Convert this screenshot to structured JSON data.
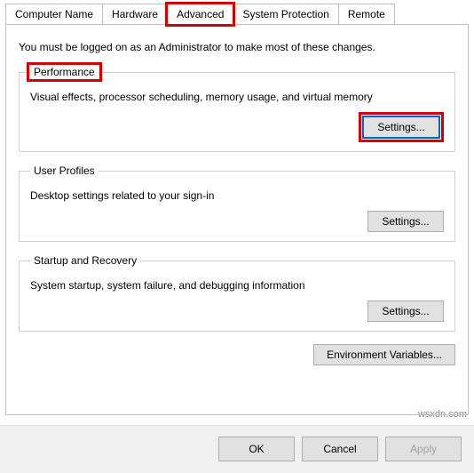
{
  "tabs": {
    "computer_name": "Computer Name",
    "hardware": "Hardware",
    "advanced": "Advanced",
    "system_protection": "System Protection",
    "remote": "Remote"
  },
  "intro": "You must be logged on as an Administrator to make most of these changes.",
  "performance": {
    "legend": "Performance",
    "desc": "Visual effects, processor scheduling, memory usage, and virtual memory",
    "button": "Settings..."
  },
  "user_profiles": {
    "legend": "User Profiles",
    "desc": "Desktop settings related to your sign-in",
    "button": "Settings..."
  },
  "startup": {
    "legend": "Startup and Recovery",
    "desc": "System startup, system failure, and debugging information",
    "button": "Settings..."
  },
  "env_button": "Environment Variables...",
  "dialog": {
    "ok": "OK",
    "cancel": "Cancel",
    "apply": "Apply"
  },
  "watermark": "wsxdn.com"
}
